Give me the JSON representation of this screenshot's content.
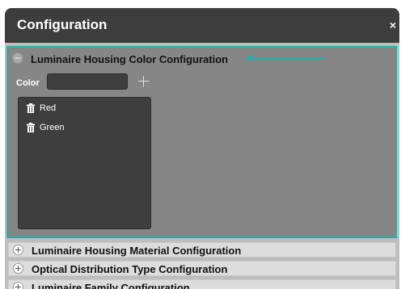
{
  "dialog": {
    "title": "Configuration",
    "close": "×"
  },
  "sections": [
    {
      "title": "Luminaire Housing Color Configuration",
      "expanded": true,
      "color_field": {
        "label": "Color",
        "value": ""
      },
      "items": [
        {
          "label": "Red",
          "icon": "trash-icon"
        },
        {
          "label": "Green",
          "icon": "trash-icon"
        }
      ]
    },
    {
      "title": "Luminaire Housing Material Configuration",
      "expanded": false
    },
    {
      "title": "Optical Distribution Type Configuration",
      "expanded": false
    },
    {
      "title": "Luminaire Family Configuration",
      "expanded": false
    }
  ],
  "colors": {
    "titlebar": "#3d3d3d",
    "accent": "#20b2aa",
    "panel": "#868686"
  }
}
